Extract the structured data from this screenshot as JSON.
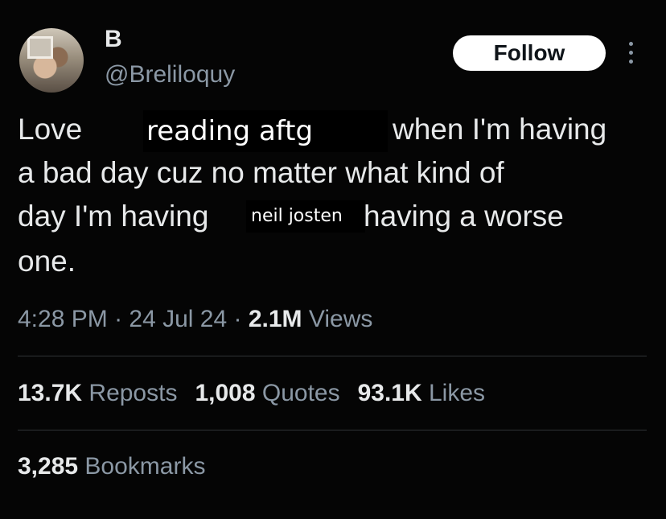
{
  "user": {
    "display_name": "B",
    "handle": "@Breliloquy"
  },
  "follow_label": "Follow",
  "tweet": {
    "line1_a": "Love",
    "line1_b": "when I'm having",
    "line2": "a bad day cuz no matter what kind of",
    "line3_a": "day I'm having",
    "line3_b": "having a worse",
    "line4": "one."
  },
  "stickers": {
    "reading": "reading aftg",
    "neil": "neil josten"
  },
  "meta": {
    "time": "4:28 PM",
    "sep1": " · ",
    "date": "24 Jul 24",
    "sep2": " · ",
    "views_count": "2.1M",
    "views_label": " Views"
  },
  "stats": {
    "reposts_count": "13.7K",
    "reposts_label": " Reposts",
    "quotes_count": "1,008",
    "quotes_label": " Quotes",
    "likes_count": "93.1K",
    "likes_label": " Likes",
    "bookmarks_count": "3,285",
    "bookmarks_label": " Bookmarks"
  },
  "icons": {
    "more": "more-vertical-icon",
    "avatar": "avatar"
  }
}
